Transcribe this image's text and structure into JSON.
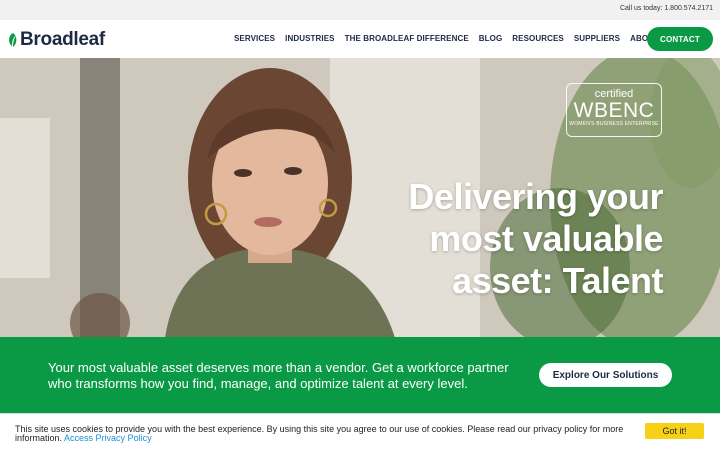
{
  "topbar": {
    "call_text": "Call us today: 1.800.574.2171"
  },
  "brand": {
    "name": "Broadleaf",
    "accent": "#0a9a46",
    "navy": "#1d2a44"
  },
  "nav": {
    "items": [
      {
        "label": "SERVICES"
      },
      {
        "label": "INDUSTRIES"
      },
      {
        "label": "THE BROADLEAF DIFFERENCE"
      },
      {
        "label": "BLOG"
      },
      {
        "label": "RESOURCES"
      },
      {
        "label": "SUPPLIERS"
      },
      {
        "label": "ABOUT"
      }
    ],
    "cta_label": "CONTACT"
  },
  "hero": {
    "headline_lines": [
      "Delivering your",
      "most valuable",
      "asset: Talent"
    ],
    "badge": {
      "certified": "certified",
      "name": "WBENC",
      "subtitle": "WOMEN'S BUSINESS ENTERPRISE"
    }
  },
  "band": {
    "text": "Your most valuable asset deserves more than a vendor. Get a workforce partner who transforms how you find, manage, and optimize talent at every level.",
    "button_label": "Explore Our Solutions"
  },
  "cookie": {
    "text": "This site uses cookies to provide you with the best experience. By using this site you agree to our use of cookies. Please read our privacy policy for more information.",
    "link_label": "Access Privacy Policy",
    "button_label": "Got it!"
  }
}
